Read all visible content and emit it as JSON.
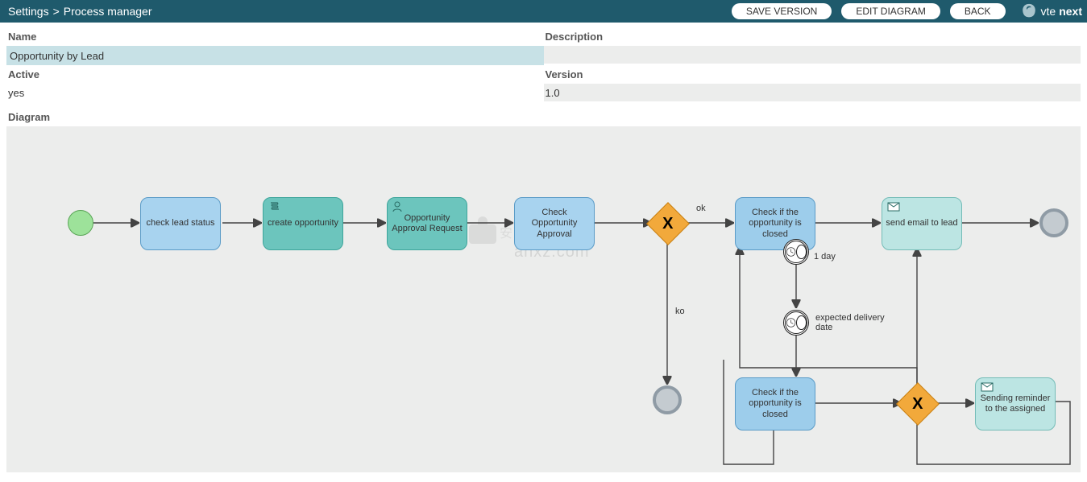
{
  "topbar": {
    "breadcrumb_a": "Settings",
    "breadcrumb_sep": ">",
    "breadcrumb_b": "Process manager",
    "btn_save": "SAVE VERSION",
    "btn_edit": "EDIT DIAGRAM",
    "btn_back": "BACK",
    "brand_a": "vte",
    "brand_b": "next"
  },
  "form": {
    "name_label": "Name",
    "name_value": "Opportunity by Lead",
    "desc_label": "Description",
    "desc_value": "",
    "active_label": "Active",
    "active_value": "yes",
    "version_label": "Version",
    "version_value": "1.0",
    "diagram_label": "Diagram"
  },
  "diagram": {
    "tasks": {
      "check_lead": "check lead status",
      "create_opp": "create opportunity",
      "approval_req": "Opportunity Approval Request",
      "check_approval": "Check Opportunity Approval",
      "check_closed_top": "Check if the opportunity is closed",
      "send_email": "send email to lead",
      "check_closed_bot": "Check if the opportunity is closed",
      "sending_reminder": "Sending reminder to the assigned"
    },
    "labels": {
      "ok": "ok",
      "ko": "ko",
      "one_day": "1 day",
      "expected": "expected delivery date"
    }
  },
  "watermark": {
    "line1": "anxz.com"
  }
}
